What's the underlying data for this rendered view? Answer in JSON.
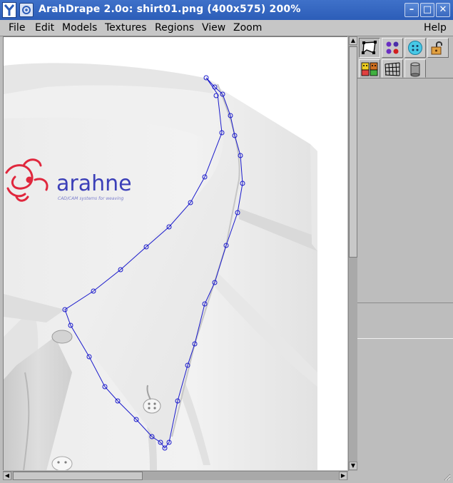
{
  "window": {
    "title": "ArahDrape 2.0o: shirt01.png (400x575) 200%",
    "buttons": {
      "minimize": "–",
      "maximize": "□",
      "close": "✕"
    }
  },
  "menu": {
    "items": [
      "File",
      "Edit",
      "Models",
      "Textures",
      "Regions",
      "View",
      "Zoom"
    ],
    "help": "Help"
  },
  "canvas": {
    "logo_text": "arahne",
    "logo_tagline": "CAD/CAM systems for weaving"
  },
  "tools": {
    "row1": [
      "polygon-select-icon",
      "four-dots-icon",
      "button-icon",
      "padlock-open-icon"
    ],
    "tabs": [
      "theater-masks-icon",
      "mesh-grid-icon",
      "cylinder-icon"
    ],
    "active_tool": "polygon-select-icon"
  },
  "colors": {
    "titlebar": "#2c5db8",
    "outline": "#1a1acc",
    "logo_blue": "#3b3fb8",
    "logo_red": "#e0273d"
  }
}
